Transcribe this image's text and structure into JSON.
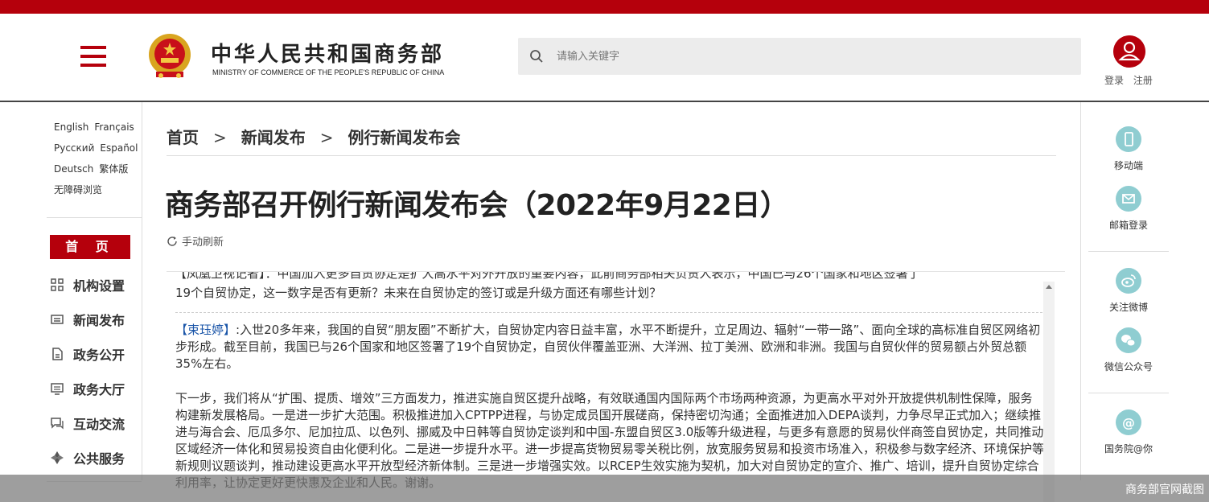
{
  "header": {
    "site_title": "中华人民共和国商务部",
    "site_subtitle": "MINISTRY OF COMMERCE OF THE PEOPLE'S REPUBLIC OF CHINA",
    "search_placeholder": "请输入关键字",
    "login": "登录",
    "register": "注册"
  },
  "languages": [
    [
      "English",
      "Français"
    ],
    [
      "Русский",
      "Español"
    ],
    [
      "Deutsch",
      "繁体版"
    ],
    [
      "无障碍浏览"
    ]
  ],
  "sidebar": {
    "home": "首 页",
    "items": [
      {
        "label": "机构设置",
        "icon": "grid-icon"
      },
      {
        "label": "新闻发布",
        "icon": "news-icon"
      },
      {
        "label": "政务公开",
        "icon": "document-icon"
      },
      {
        "label": "政务大厅",
        "icon": "monitor-icon"
      },
      {
        "label": "互动交流",
        "icon": "chat-icon"
      },
      {
        "label": "公共服务",
        "icon": "service-icon"
      }
    ]
  },
  "breadcrumb": [
    "首页",
    "新闻发布",
    "例行新闻发布会"
  ],
  "article": {
    "title": "商务部召开例行新闻发布会（2022年9月22日）",
    "refresh": "手动刷新",
    "clipped_line": "【凤凰卫视记者】：中国加入更多自贸协定是扩大高水平对外开放的重要内容，此前商务部相关负责人表示，中国已与26个国家和地区签署了",
    "question_tail": "19个自贸协定，这一数字是否有更新？未来在自贸协定的签订或是升级方面还有哪些计划？",
    "speaker": "【束珏婷】",
    "answer_1": ":入世20多年来，我国的自贸“朋友圈”不断扩大，自贸协定内容日益丰富，水平不断提升，立足周边、辐射“一带一路”、面向全球的高标准自贸区网络初步形成。截至目前，我国已与26个国家和地区签署了19个自贸协定，自贸伙伴覆盖亚洲、大洋洲、拉丁美洲、欧洲和非洲。我国与自贸伙伴的贸易额占外贸总额35%左右。",
    "answer_2": "下一步，我们将从“扩围、提质、增效”三方面发力，推进实施自贸区提升战略，有效联通国内国际两个市场两种资源，为更高水平对外开放提供机制性保障，服务构建新发展格局。一是进一步扩大范围。积极推进加入CPTPP进程，与协定成员国开展磋商，保持密切沟通；全面推进加入DEPA谈判，力争尽早正式加入；继续推进与海合会、厄瓜多尔、尼加拉瓜、以色列、挪威及中日韩等自贸协定谈判和中国-东盟自贸区3.0版等升级进程，与更多有意愿的贸易伙伴商签自贸协定，共同推动区域经济一体化和贸易投资自由化便利化。二是进一步提升水平。进一步提高货物贸易零关税比例，放宽服务贸易和投资市场准入，积极参与数字经济、环境保护等新规则议题谈判，推动建设更高水平开放型经济新体制。三是进一步增强实效。以RCEP生效实施为契机，加大对自贸协定的宣介、推广、培训，提升自贸协定综合利用率，让协定更好更快惠及企业和人民。谢谢。"
  },
  "right_panel": [
    {
      "label": "移动端",
      "icon": "mobile-icon"
    },
    {
      "label": "邮箱登录",
      "icon": "mail-icon"
    },
    {
      "label": "关注微博",
      "icon": "weibo-icon"
    },
    {
      "label": "微信公众号",
      "icon": "wechat-icon"
    },
    {
      "label": "国务院@你",
      "icon": "at-icon"
    }
  ],
  "watermark": "商务部官网截图",
  "colors": {
    "brand_red": "#b5000c",
    "icon_teal": "#8fcdd1",
    "speaker_blue": "#1a55a8"
  }
}
